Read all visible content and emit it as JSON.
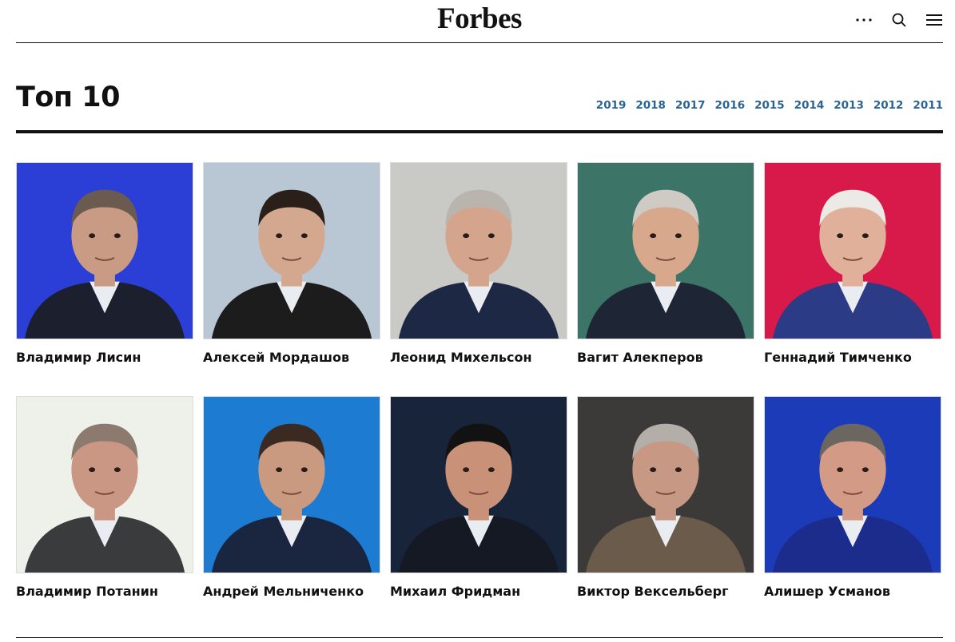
{
  "header": {
    "logo": "Forbes",
    "icons": [
      "more-icon",
      "search-icon",
      "menu-icon"
    ]
  },
  "section": {
    "title": "Топ 10",
    "years": [
      "2019",
      "2018",
      "2017",
      "2016",
      "2015",
      "2014",
      "2013",
      "2012",
      "2011"
    ]
  },
  "people": [
    {
      "name": "Владимир Лисин",
      "bg": "#2b3fd6",
      "suit": "#1b1f2e",
      "skin": "#c99a84",
      "hair": "#6b5a4f"
    },
    {
      "name": "Алексей Мордашов",
      "bg": "#b9c6d3",
      "suit": "#1d1c1c",
      "skin": "#d3a88e",
      "hair": "#2a2019"
    },
    {
      "name": "Леонид Михельсон",
      "bg": "#c9c9c6",
      "suit": "#1c2844",
      "skin": "#d4a58c",
      "hair": "#b9b5ae"
    },
    {
      "name": "Вагит Алекперов",
      "bg": "#3d7468",
      "suit": "#1e2535",
      "skin": "#d8a88d",
      "hair": "#cfcac4"
    },
    {
      "name": "Геннадий Тимченко",
      "bg": "#d81a4a",
      "suit": "#2b3b86",
      "skin": "#e0b09a",
      "hair": "#ebeae6"
    },
    {
      "name": "Владимир Потанин",
      "bg": "#eef1ea",
      "suit": "#3a3b3d",
      "skin": "#c99783",
      "hair": "#8c7a6e"
    },
    {
      "name": "Андрей Мельниченко",
      "bg": "#1d7bd1",
      "suit": "#1a2540",
      "skin": "#c99a80",
      "hair": "#3a2a22"
    },
    {
      "name": "Михаил Фридман",
      "bg": "#18243a",
      "suit": "#141923",
      "skin": "#c89178",
      "hair": "#121212"
    },
    {
      "name": "Виктор Вексельберг",
      "bg": "#3b3a39",
      "suit": "#6b5b4a",
      "skin": "#c79985",
      "hair": "#b4aea8"
    },
    {
      "name": "Алишер Усманов",
      "bg": "#1c3bb8",
      "suit": "#1c2c8c",
      "skin": "#d39b85",
      "hair": "#6b6660"
    }
  ]
}
